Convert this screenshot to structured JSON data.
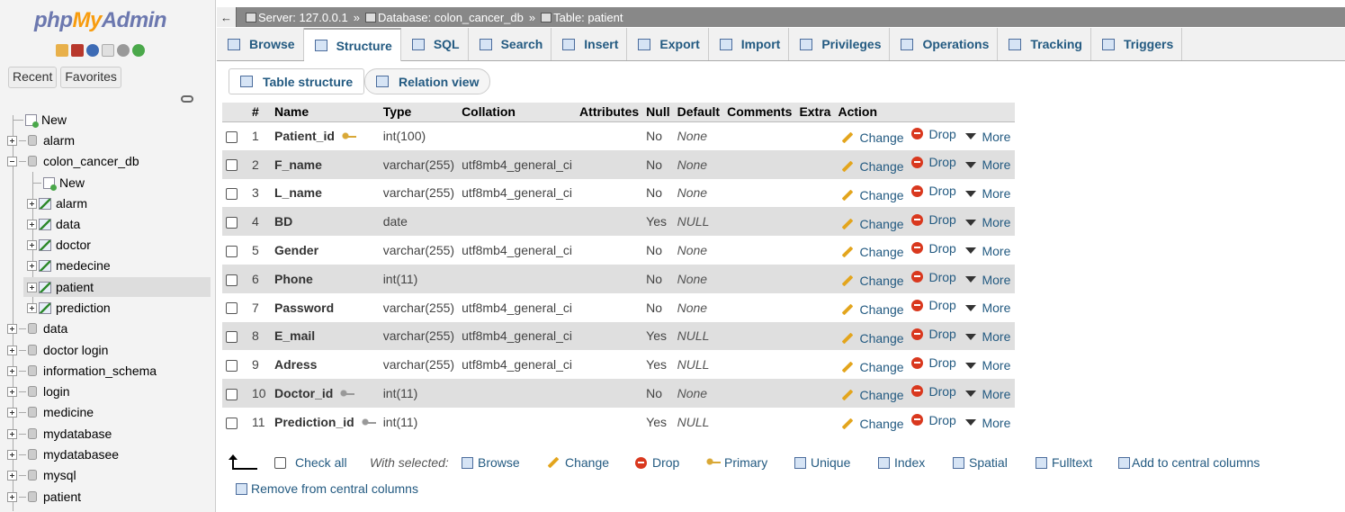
{
  "app": {
    "logo_php": "php",
    "logo_my": "My",
    "logo_admin": "Admin"
  },
  "nav": {
    "tabs": [
      "Recent",
      "Favorites"
    ],
    "new_label": "New",
    "databases": [
      "alarm",
      "colon_cancer_db",
      "data",
      "doctor login",
      "information_schema",
      "login",
      "medicine",
      "mydatabase",
      "mydatabasee",
      "mysql",
      "patient"
    ],
    "colon_new": "New",
    "colon_tables": [
      "alarm",
      "data",
      "doctor",
      "medecine",
      "patient",
      "prediction"
    ]
  },
  "breadcrumb": {
    "server": "Server: 127.0.0.1",
    "database": "Database: colon_cancer_db",
    "table": "Table: patient",
    "separator": "»"
  },
  "tabs": [
    "Browse",
    "Structure",
    "SQL",
    "Search",
    "Insert",
    "Export",
    "Import",
    "Privileges",
    "Operations",
    "Tracking",
    "Triggers"
  ],
  "active_tab": "Structure",
  "subtabs": {
    "table_structure": "Table structure",
    "relation_view": "Relation view"
  },
  "columns": [
    "#",
    "Name",
    "Type",
    "Collation",
    "Attributes",
    "Null",
    "Default",
    "Comments",
    "Extra",
    "Action"
  ],
  "rows": [
    {
      "num": "1",
      "name": "Patient_id",
      "type": "int(100)",
      "collation": "",
      "null": "No",
      "default": "None",
      "key": "primary"
    },
    {
      "num": "2",
      "name": "F_name",
      "type": "varchar(255)",
      "collation": "utf8mb4_general_ci",
      "null": "No",
      "default": "None",
      "key": ""
    },
    {
      "num": "3",
      "name": "L_name",
      "type": "varchar(255)",
      "collation": "utf8mb4_general_ci",
      "null": "No",
      "default": "None",
      "key": ""
    },
    {
      "num": "4",
      "name": "BD",
      "type": "date",
      "collation": "",
      "null": "Yes",
      "default": "NULL",
      "key": ""
    },
    {
      "num": "5",
      "name": "Gender",
      "type": "varchar(255)",
      "collation": "utf8mb4_general_ci",
      "null": "No",
      "default": "None",
      "key": ""
    },
    {
      "num": "6",
      "name": "Phone",
      "type": "int(11)",
      "collation": "",
      "null": "No",
      "default": "None",
      "key": ""
    },
    {
      "num": "7",
      "name": "Password",
      "type": "varchar(255)",
      "collation": "utf8mb4_general_ci",
      "null": "No",
      "default": "None",
      "key": ""
    },
    {
      "num": "8",
      "name": "E_mail",
      "type": "varchar(255)",
      "collation": "utf8mb4_general_ci",
      "null": "Yes",
      "default": "NULL",
      "key": ""
    },
    {
      "num": "9",
      "name": "Adress",
      "type": "varchar(255)",
      "collation": "utf8mb4_general_ci",
      "null": "Yes",
      "default": "NULL",
      "key": ""
    },
    {
      "num": "10",
      "name": "Doctor_id",
      "type": "int(11)",
      "collation": "",
      "null": "No",
      "default": "None",
      "key": "index"
    },
    {
      "num": "11",
      "name": "Prediction_id",
      "type": "int(11)",
      "collation": "",
      "null": "Yes",
      "default": "NULL",
      "key": "index"
    }
  ],
  "row_actions": {
    "change": "Change",
    "drop": "Drop",
    "more": "More"
  },
  "bulk": {
    "check_all": "Check all",
    "with_selected": "With selected:",
    "browse": "Browse",
    "change": "Change",
    "drop": "Drop",
    "primary": "Primary",
    "unique": "Unique",
    "index": "Index",
    "spatial": "Spatial",
    "fulltext": "Fulltext",
    "add_central": "Add to central columns",
    "remove_central": "Remove from central columns"
  },
  "colors": {
    "link": "#235a81",
    "breadcrumb_bg": "#888888",
    "row_alt": "#dfdfdf"
  }
}
